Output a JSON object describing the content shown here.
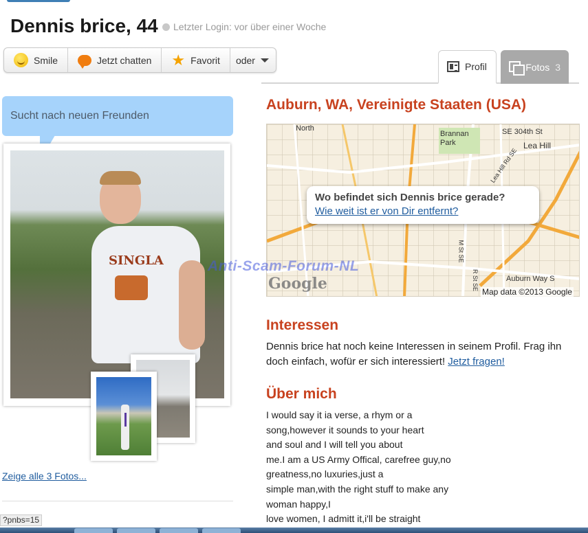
{
  "profile": {
    "name": "Dennis brice, 44",
    "last_login": "Letzter Login: vor über einer Woche"
  },
  "actions": {
    "smile": "Smile",
    "chat": "Jetzt chatten",
    "favorite": "Favorit",
    "more": "oder"
  },
  "tabs": {
    "profile": "Profil",
    "photos": "Fotos",
    "photos_count": "3"
  },
  "left": {
    "bubble": "Sucht nach neuen Freunden",
    "shirt_text": "SINGLA",
    "show_all_photos": "Zeige alle 3 Fotos..."
  },
  "location": {
    "title": "Auburn, WA, Vereinigte Staaten (USA)",
    "map_question": "Wo befindet sich Dennis brice gerade?",
    "map_link": "Wie weit ist er von Dir entfernt?",
    "map_logo": "Google",
    "map_attribution": "Map data ©2013 Google",
    "map_labels": [
      "North",
      "Brannan Park",
      "SE 304th St",
      "Lea Hill",
      "Lea Hill Rd SE",
      "Auburn Way S",
      "M St SE",
      "R St SE"
    ]
  },
  "watermark": "Anti-Scam-Forum-NL",
  "interests": {
    "title": "Interessen",
    "text": "Dennis brice hat noch keine Interessen in seinem Profil. Frag ihn doch einfach, wofür er sich interessiert!",
    "link": "Jetzt fragen!"
  },
  "about": {
    "title": "Über mich",
    "lines": [
      "I would say it ia verse, a rhym or a",
      "song,however it sounds to your heart",
      "and soul and I will tell you about",
      "me.I am a US Army Offical, carefree guy,no",
      "greatness,no luxuries,just a",
      "simple man,with the right stuff to make any",
      "woman happy,I",
      "love women, I admitt it,i'll be straight"
    ]
  },
  "statusbar": {
    "url": "?pnbs=15"
  },
  "colors": {
    "accent": "#c8421f",
    "link": "#1f5c9e",
    "bubble": "#a6d3fb"
  }
}
